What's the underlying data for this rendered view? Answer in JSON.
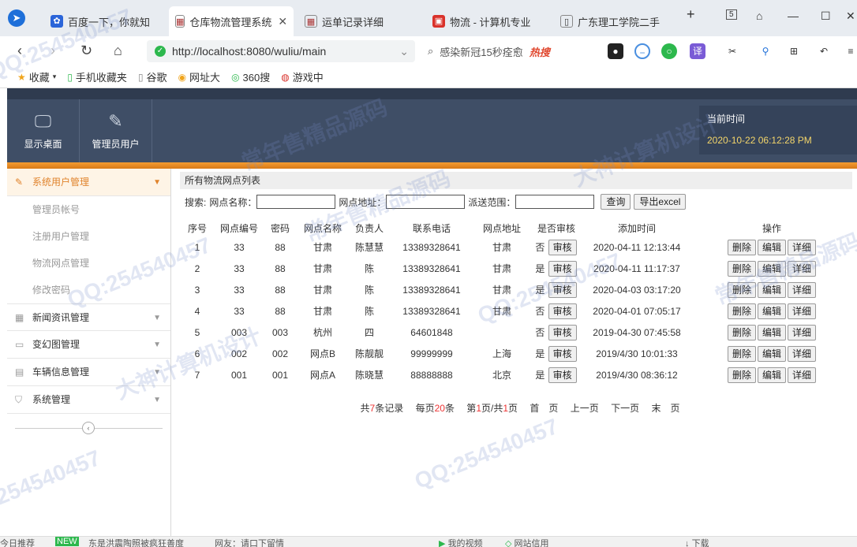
{
  "browser": {
    "tabs": [
      {
        "label": "百度一下，你就知",
        "active": false
      },
      {
        "label": "仓库物流管理系统",
        "active": true
      },
      {
        "label": "运单记录详细",
        "active": false
      },
      {
        "label": "物流 - 计算机专业",
        "active": false
      },
      {
        "label": "广东理工学院二手",
        "active": false
      }
    ],
    "new_tab": "+",
    "tab_count": "5",
    "url": "http://localhost:8080/wuliu/main",
    "search_text": "感染新冠15秒痊愈",
    "search_hot": "热搜",
    "bookmarks": [
      "收藏",
      "手机收藏夹",
      "谷歌",
      "网址大",
      "360搜",
      "游戏中"
    ]
  },
  "header": {
    "buttons": [
      {
        "label": "显示桌面",
        "icon": "monitor-icon"
      },
      {
        "label": "管理员用户",
        "icon": "pencil-icon"
      }
    ],
    "time_label": "当前时间",
    "time_value": "2020-10-22 06:12:28 PM"
  },
  "sidebar": {
    "menus": [
      {
        "label": "系统用户管理",
        "icon": "pencil-icon",
        "expanded": true,
        "items": [
          "管理员帐号",
          "注册用户管理",
          "物流网点管理",
          "修改密码"
        ]
      },
      {
        "label": "新闻资讯管理",
        "icon": "grid-icon"
      },
      {
        "label": "变幻图管理",
        "icon": "image-icon"
      },
      {
        "label": "车辆信息管理",
        "icon": "truck-icon"
      },
      {
        "label": "系统管理",
        "icon": "shield-icon"
      }
    ]
  },
  "main": {
    "title": "所有物流网点列表",
    "search": {
      "label": "搜索:",
      "name_label": "网点名称：",
      "address_label": "网点地址：",
      "range_label": "派送范围：",
      "query_button": "查询",
      "export_button": "导出excel"
    },
    "columns": [
      "序号",
      "网点编号",
      "密码",
      "网点名称",
      "负责人",
      "联系电话",
      "网点地址",
      "是否审核",
      "添加时间",
      "操作"
    ],
    "audit_button": "审核",
    "action_buttons": [
      "删除",
      "编辑",
      "详细"
    ],
    "rows": [
      {
        "no": "1",
        "code": "33",
        "pwd": "88",
        "name": "甘肃",
        "owner": "陈慧慧",
        "phone": "13389328641",
        "address": "甘肃",
        "audited": "否",
        "time": "2020-04-11 12:13:44"
      },
      {
        "no": "2",
        "code": "33",
        "pwd": "88",
        "name": "甘肃",
        "owner": "陈",
        "phone": "13389328641",
        "address": "甘肃",
        "audited": "是",
        "time": "2020-04-11 11:17:37"
      },
      {
        "no": "3",
        "code": "33",
        "pwd": "88",
        "name": "甘肃",
        "owner": "陈",
        "phone": "13389328641",
        "address": "甘肃",
        "audited": "是",
        "time": "2020-04-03 03:17:20"
      },
      {
        "no": "4",
        "code": "33",
        "pwd": "88",
        "name": "甘肃",
        "owner": "陈",
        "phone": "13389328641",
        "address": "甘肃",
        "audited": "否",
        "time": "2020-04-01 07:05:17"
      },
      {
        "no": "5",
        "code": "003",
        "pwd": "003",
        "name": "杭州",
        "owner": "四",
        "phone": "64601848",
        "address": "",
        "audited": "否",
        "time": "2019-04-30 07:45:58"
      },
      {
        "no": "6",
        "code": "002",
        "pwd": "002",
        "name": "网点B",
        "owner": "陈靓靓",
        "phone": "99999999",
        "address": "上海",
        "audited": "是",
        "time": "2019/4/30 10:01:33"
      },
      {
        "no": "7",
        "code": "001",
        "pwd": "001",
        "name": "网点A",
        "owner": "陈晓慧",
        "phone": "88888888",
        "address": "北京",
        "audited": "是",
        "time": "2019/4/30 08:36:12"
      }
    ],
    "pager": {
      "total_pre": "共",
      "total": "7",
      "total_post": "条记录",
      "per_pre": "每页",
      "per": "20",
      "per_post": "条",
      "page_pre": "第",
      "page": "1",
      "page_mid": "页/共",
      "pages": "1",
      "page_post": "页",
      "first": "首　页",
      "prev": "上一页",
      "next": "下一页",
      "last": "末　页"
    }
  },
  "statusbar": {
    "left": "今日推荐",
    "news": "东是洪震陶照被疯狂善度",
    "news2": "网友：请口下留情",
    "video": "我的视频",
    "speed": "网站信用",
    "download": "下载"
  },
  "watermarks": [
    "QQ:254540457",
    "常年售精品源码",
    "大神计算机设计",
    "QQ:254540457",
    "常年售精品源码",
    "QQ:254540457",
    "大神计算机设计",
    "QQ:254540457",
    "常年售精品源码",
    "QQ:254540457"
  ]
}
